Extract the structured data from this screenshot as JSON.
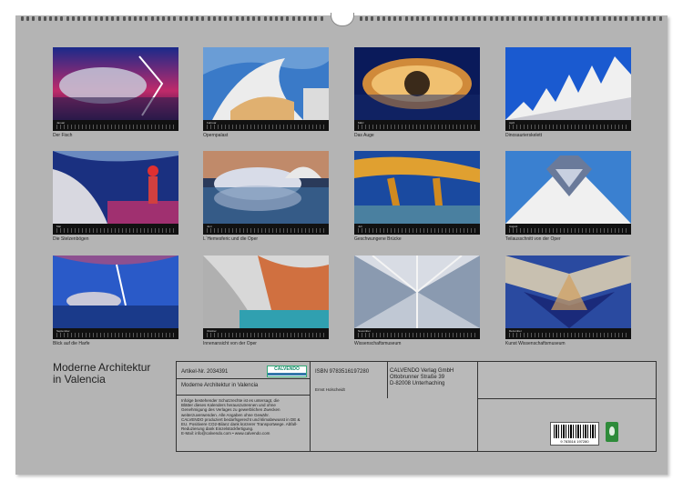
{
  "calendar": {
    "title_line1": "Moderne Architektur",
    "title_line2": "in Valencia",
    "months": [
      {
        "month": "Januar",
        "caption": "Der Fisch"
      },
      {
        "month": "Februar",
        "caption": "Opernpalast"
      },
      {
        "month": "März",
        "caption": "Das Auge"
      },
      {
        "month": "April",
        "caption": "Dinosaurierskelett"
      },
      {
        "month": "Mai",
        "caption": "Die Stelzenbögen"
      },
      {
        "month": "Juni",
        "caption": "L´Hemesferic und die Oper"
      },
      {
        "month": "Juli",
        "caption": "Geschwungene Brücke"
      },
      {
        "month": "August",
        "caption": "Teilausschnitt von der Oper"
      },
      {
        "month": "September",
        "caption": "Blick auf die Harfe"
      },
      {
        "month": "Oktober",
        "caption": "Innenansicht von der Oper"
      },
      {
        "month": "November",
        "caption": "Wissenschaftsmuseum"
      },
      {
        "month": "Dezember",
        "caption": "Kunst Wissenschaftsmuseum"
      }
    ]
  },
  "info": {
    "article_nr": "Artikel-Nr. 2034391",
    "logo": "CALVENDO",
    "product_title": "Moderne Architektur in Valencia",
    "legal_lines": [
      "Infolge bestehender Schutzrechte ist es untersagt, die",
      "Blätter dieses Kalenders herauszutrennen und ohne",
      "Genehmigung des Verlages zu gewerblichen Zwecken",
      "weiterzuverwenden. Alle Angaben ohne Gewähr.",
      "CALVENDO produziert bedarfsgerecht und klimabewusst in DE &",
      "EU. Positivere CO2-Bilanz dank kürzerer Transportwege. Abfall-",
      "Reduzierung dank Einzelstückfertigung.",
      "E-Mail: info@calvendo.com • www.calvendo.com"
    ],
    "isbn": "ISBN 9783516197280",
    "author": "Ernst Holscheidt",
    "publisher_lines": [
      "CALVENDO Verlag GmbH",
      "Ottobrunner Straße 39",
      "D-82008 Unterhaching"
    ],
    "barcode_number": "9 783516 197280"
  },
  "colors": {
    "sheet": "#b4b4b4",
    "strip": "#111111",
    "box_border": "#333333"
  }
}
